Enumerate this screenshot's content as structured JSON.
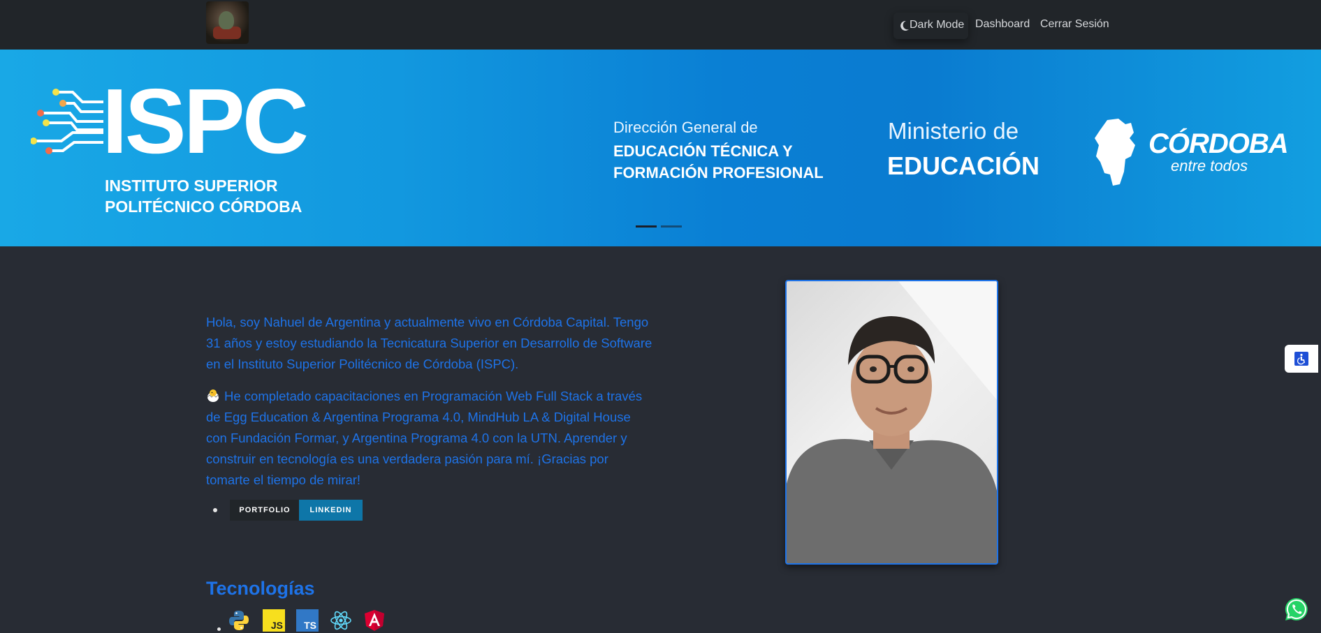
{
  "navbar": {
    "dark_mode": "Dark Mode",
    "dashboard": "Dashboard",
    "logout": "Cerrar Sesión"
  },
  "hero": {
    "ispc_title": "ISPC",
    "ispc_sub_1": "INSTITUTO SUPERIOR",
    "ispc_sub_2": "POLITÉCNICO CÓRDOBA",
    "dg_line1": "Dirección General de",
    "dg_line2": "EDUCACIÓN TÉCNICA Y",
    "dg_line3": "FORMACIÓN PROFESIONAL",
    "min_line1": "Ministerio de",
    "min_line2": "EDUCACIÓN",
    "cba_title": "CÓRDOBA",
    "cba_sub": "entre todos",
    "active_slide": 1,
    "slide_count": 2
  },
  "about": {
    "paragraph1": "Hola, soy Nahuel de Argentina y actualmente vivo en Córdoba Capital. Tengo 31 años y estoy estudiando la Tecnicatura Superior en Desarrollo de Software en el Instituto Superior Politécnico de Córdoba (ISPC).",
    "paragraph2": "He completado capacitaciones en Programación Web Full Stack a través de Egg Education & Argentina Programa 4.0, MindHub LA & Digital House con Fundación Formar, y Argentina Programa 4.0 con la UTN. Aprender y construir en tecnología es una verdadera pasión para mí. ¡Gracias por tomarte el tiempo de mirar!",
    "portfolio_button": "PORTFOLIO",
    "linkedin_button": "LINKEDIN"
  },
  "tech": {
    "title": "Tecnologías",
    "icons": [
      "python-icon",
      "javascript-icon",
      "typescript-icon",
      "react-icon",
      "angular-icon"
    ],
    "js_label": "JS",
    "ts_label": "TS"
  },
  "colors": {
    "accent": "#1e73e8",
    "navbar_bg": "#212529",
    "page_bg": "#282c34",
    "linkedin": "#0e76a8"
  }
}
